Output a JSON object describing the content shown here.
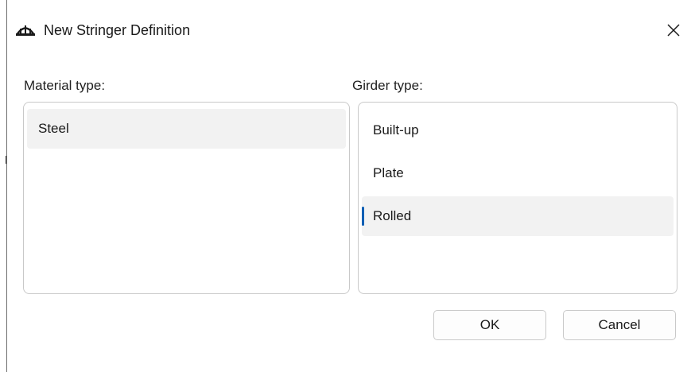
{
  "dialog": {
    "title": "New Stringer Definition",
    "icon": "bridge-app-icon",
    "close_icon": "close-icon"
  },
  "material": {
    "label": "Material type:",
    "items": [
      {
        "label": "Steel",
        "selected": true
      }
    ]
  },
  "girder": {
    "label": "Girder type:",
    "items": [
      {
        "label": "Built-up",
        "selected": false
      },
      {
        "label": "Plate",
        "selected": false
      },
      {
        "label": "Rolled",
        "selected": true
      }
    ]
  },
  "buttons": {
    "ok_label": "OK",
    "cancel_label": "Cancel"
  },
  "colors": {
    "selection_background": "#f2f2f2",
    "selection_indicator": "#0a5fb4",
    "border": "#c9c9c9"
  }
}
